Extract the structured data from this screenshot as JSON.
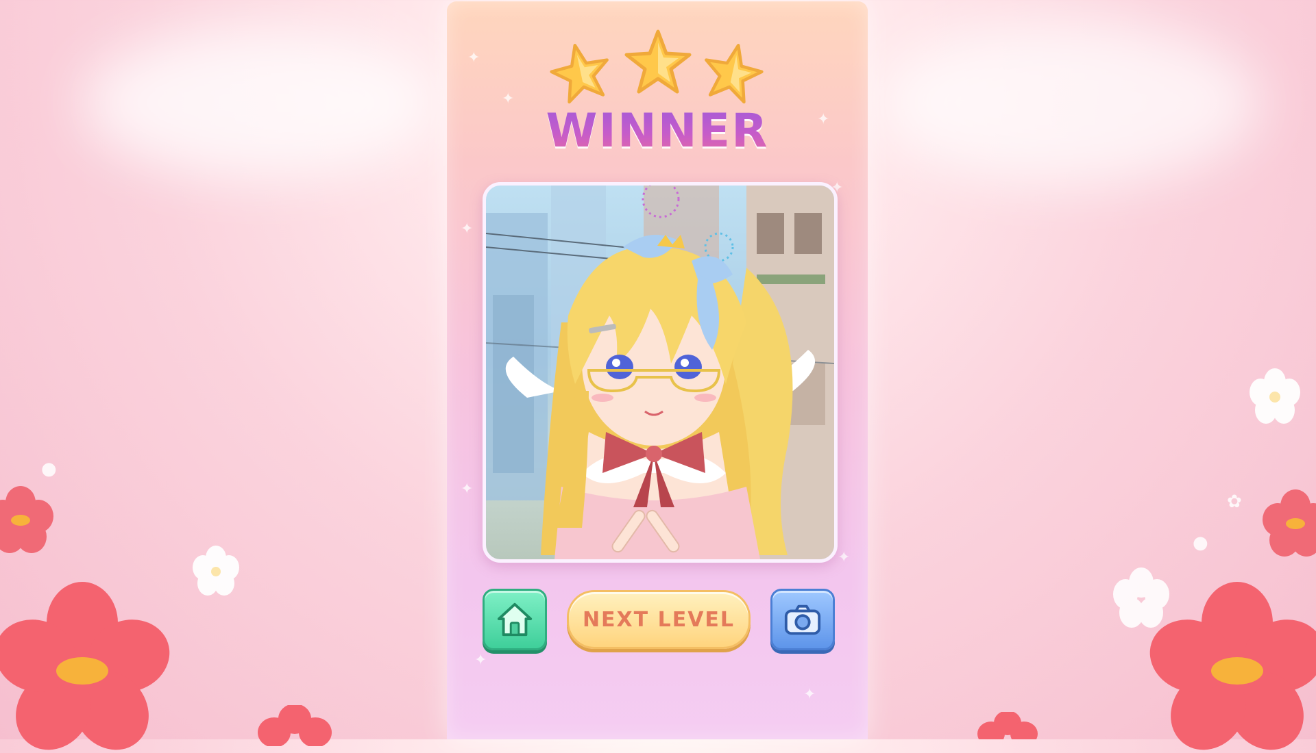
{
  "result": {
    "title": "WINNER",
    "stars_earned": 3,
    "stars_total": 3
  },
  "character": {
    "hair_color": "#f7d66a",
    "eye_color": "#4f63d8",
    "bow_color": "#c9545c"
  },
  "buttons": {
    "home_icon": "home-icon",
    "next_label": "NEXT LEVEL",
    "camera_icon": "camera-icon"
  },
  "colors": {
    "accent_green": "#3fcf9a",
    "accent_gold": "#ffd47e",
    "accent_blue": "#5e95ea",
    "title_purple": "#a25ad9"
  }
}
